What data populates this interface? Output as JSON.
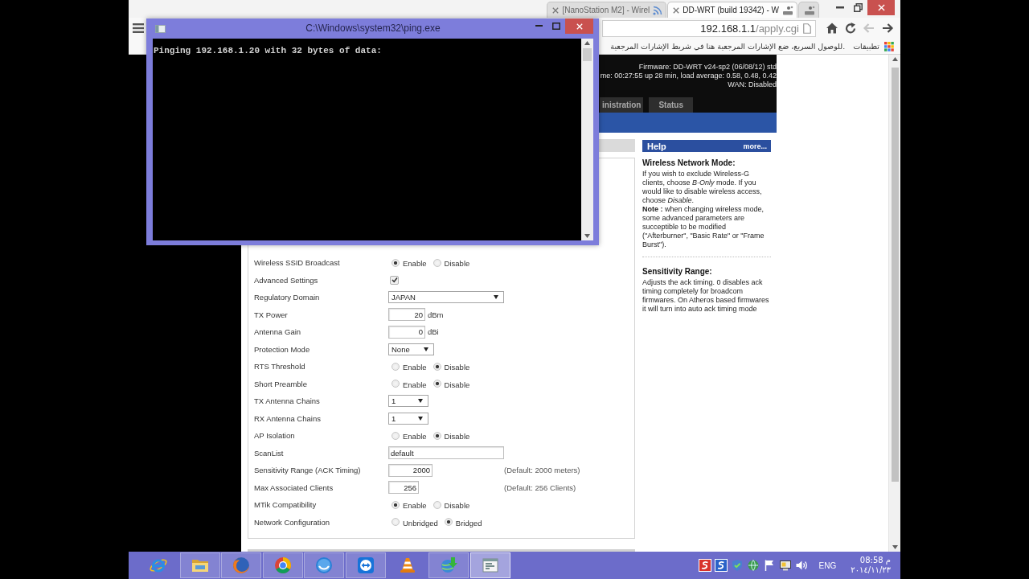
{
  "browser": {
    "tabs": [
      {
        "kind": "feed",
        "title": "[NanoStation M2] - Wirel",
        "selected": false
      },
      {
        "kind": "logo",
        "title": "DD-WRT (build 19342) - W",
        "selected": true
      },
      {
        "kind": "logo",
        "selected": false
      }
    ],
    "address": {
      "host": "192.168.1.1",
      "path": "/apply.cgi"
    },
    "nav": [
      {
        "kind": "home",
        "disabled": false
      },
      {
        "kind": "reload",
        "disabled": false
      },
      {
        "kind": "arrow_left",
        "disabled": true
      },
      {
        "kind": "arrow_right",
        "disabled": false
      }
    ],
    "bookmarks": {
      "hint": "للوصول السريع، ضع الإشارات المرجعية هنا في شريط الإشارات المرجعية.",
      "apps": "تطبيقات"
    }
  },
  "console": {
    "title": "C:\\Windows\\system32\\ping.exe",
    "lines": [
      "Pinging 192.168.1.20 with 32 bytes of data:"
    ]
  },
  "router": {
    "status": [
      "Firmware: DD-WRT v24-sp2 (06/08/12) std",
      "me: 00:27:55 up 28 min, load average: 0.58, 0.48, 0.42",
      "WAN: Disabled"
    ],
    "tabs": [
      {
        "label": "inistration",
        "selected": false
      },
      {
        "label": "Status",
        "selected": false
      }
    ]
  },
  "settings": {
    "rows": [
      {
        "label": "Wireless SSID Broadcast",
        "kind": "radio",
        "options": [
          {
            "label": "Enable",
            "selected": true
          },
          {
            "label": "Disable",
            "selected": false
          }
        ]
      },
      {
        "label": "Advanced Settings",
        "kind": "checkbox",
        "checked": true
      },
      {
        "label": "Regulatory Domain",
        "kind": "select",
        "value": "JAPAN"
      },
      {
        "label": "TX Power",
        "kind": "number",
        "value": "20",
        "unit": "dBm"
      },
      {
        "label": "Antenna Gain",
        "kind": "number",
        "value": "0",
        "unit": "dBi"
      },
      {
        "label": "Protection Mode",
        "kind": "select",
        "value": "None"
      },
      {
        "label": "RTS Threshold",
        "kind": "radio",
        "options": [
          {
            "label": "Enable",
            "selected": false
          },
          {
            "label": "Disable",
            "selected": true
          }
        ]
      },
      {
        "label": "Short Preamble",
        "kind": "radio",
        "options": [
          {
            "label": "Enable",
            "selected": false
          },
          {
            "label": "Disable",
            "selected": true
          }
        ]
      },
      {
        "label": "TX Antenna Chains",
        "kind": "select",
        "value": "1"
      },
      {
        "label": "RX Antenna Chains",
        "kind": "select",
        "value": "1"
      },
      {
        "label": "AP Isolation",
        "kind": "radio",
        "options": [
          {
            "label": "Enable",
            "selected": false
          },
          {
            "label": "Disable",
            "selected": true
          }
        ]
      },
      {
        "label": "ScanList",
        "kind": "text",
        "value": "default"
      },
      {
        "label": "Sensitivity Range (ACK Timing)",
        "kind": "number",
        "value": "2000",
        "note": "(Default: 2000 meters)"
      },
      {
        "label": "Max Associated Clients",
        "kind": "number",
        "value": "256",
        "note": "(Default: 256 Clients)"
      },
      {
        "label": "MTik Compatibility",
        "kind": "radio",
        "options": [
          {
            "label": "Enable",
            "selected": true
          },
          {
            "label": "Disable",
            "selected": false
          }
        ]
      },
      {
        "label": "Network Configuration",
        "kind": "radio",
        "options": [
          {
            "label": "Unbridged",
            "selected": false
          },
          {
            "label": "Bridged",
            "selected": true
          }
        ]
      }
    ]
  },
  "help": {
    "title": "Help",
    "more": "more...",
    "sections": [
      {
        "heading": "Wireless Network Mode:",
        "paragraphs": [
          "If you wish to exclude Wireless-G clients, choose *B-Only* mode. If you would like to disable wireless access, choose *Disable*.",
          "**Note :** when changing wireless mode, some advanced parameters are succeptible to be modified (\"Afterburner\", \"Basic Rate\" or \"Frame Burst\")."
        ]
      },
      {
        "heading": "Sensitivity Range:",
        "paragraphs": [
          "Adjusts the ack timing. 0 disables ack timing completely for broadcom firmwares. On Atheros based firmwares it will turn into auto ack timing mode"
        ]
      }
    ]
  },
  "taskbar": {
    "apps": [
      {
        "kind": "e",
        "open": false,
        "selected": false
      },
      {
        "kind": "folder",
        "open": true,
        "selected": false
      },
      {
        "kind": "fox",
        "open": true,
        "selected": false
      },
      {
        "kind": "wheel",
        "open": true,
        "selected": false
      },
      {
        "kind": "disc",
        "open": true,
        "selected": false
      },
      {
        "kind": "arrows",
        "open": true,
        "selected": false
      },
      {
        "kind": "cone",
        "open": false,
        "selected": false
      },
      {
        "kind": "globe",
        "open": true,
        "selected": false
      },
      {
        "kind": "console",
        "open": true,
        "selected": true
      }
    ],
    "tray": [
      {
        "kind": "tile_red"
      },
      {
        "kind": "tile_blue"
      },
      {
        "kind": "shield"
      },
      {
        "kind": "network"
      },
      {
        "kind": "flag"
      },
      {
        "kind": "monitor"
      },
      {
        "kind": "speaker"
      }
    ],
    "language": "ENG",
    "time": "08:58 م",
    "date": "٢٠١٤/١١/٢٣"
  }
}
